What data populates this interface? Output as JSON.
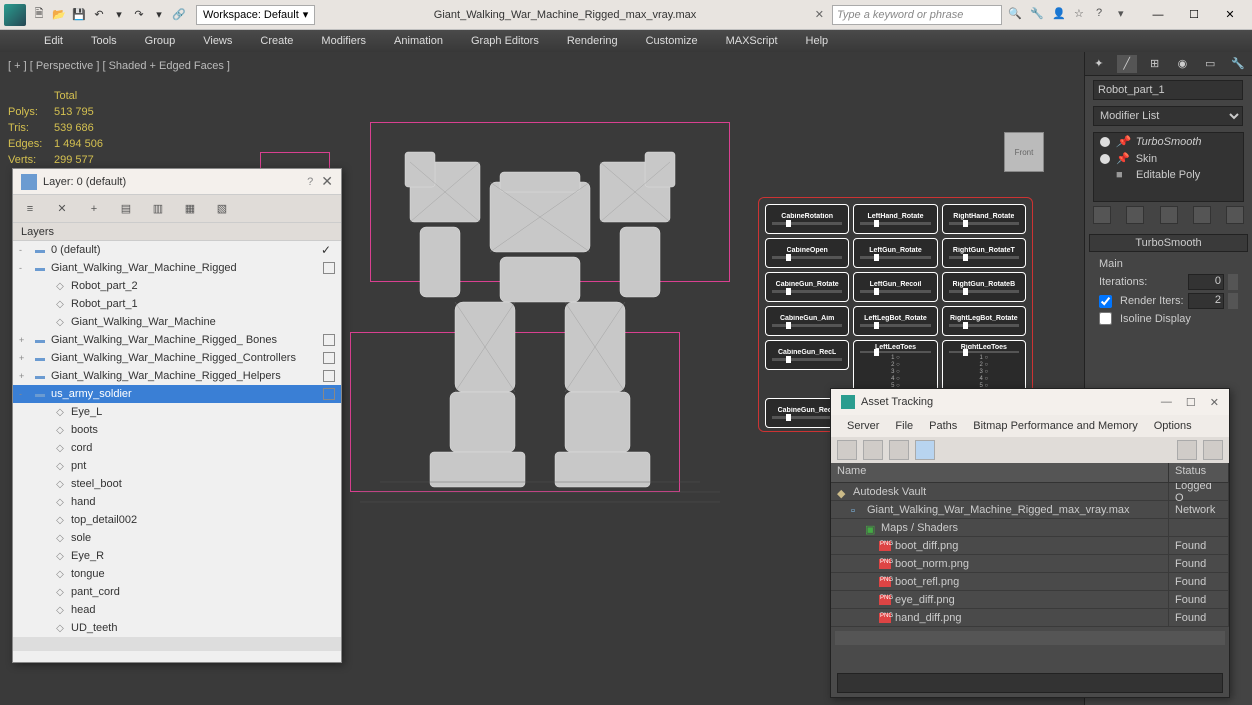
{
  "titlebar": {
    "workspace_label": "Workspace: Default",
    "filename": "Giant_Walking_War_Machine_Rigged_max_vray.max",
    "search_placeholder": "Type a keyword or phrase"
  },
  "menubar": [
    "Edit",
    "Tools",
    "Group",
    "Views",
    "Create",
    "Modifiers",
    "Animation",
    "Graph Editors",
    "Rendering",
    "Customize",
    "MAXScript",
    "Help"
  ],
  "viewport": {
    "label": "[ + ] [ Perspective ] [ Shaded + Edged Faces ]",
    "stats_header": "Total",
    "stats": [
      {
        "label": "Polys:",
        "value": "513 795"
      },
      {
        "label": "Tris:",
        "value": "539 686"
      },
      {
        "label": "Edges:",
        "value": "1 494 506"
      },
      {
        "label": "Verts:",
        "value": "299 577"
      }
    ],
    "viewcube_face": "Front"
  },
  "controls": [
    {
      "label": "CabineRotation"
    },
    {
      "label": "LeftHand_Rotate"
    },
    {
      "label": "RightHand_Rotate"
    },
    {
      "label": "CabineOpen"
    },
    {
      "label": "LeftGun_Rotate"
    },
    {
      "label": "RightGun_RotateT"
    },
    {
      "label": "CabineGun_Rotate"
    },
    {
      "label": "LeftGun_Recoil"
    },
    {
      "label": "RightGun_RotateB"
    },
    {
      "label": "CabineGun_Aim"
    },
    {
      "label": "LeftLegBot_Rotate"
    },
    {
      "label": "RightLegBot_Rotate"
    },
    {
      "label": "CabineGun_RecL"
    },
    {
      "label": "LeftLegToes",
      "tall": true
    },
    {
      "label": "RightLegToes",
      "tall": true
    },
    {
      "label": "CabineGun_RecR"
    }
  ],
  "cmd_panel": {
    "selected_name": "Robot_part_1",
    "modifier_list_label": "Modifier List",
    "stack": [
      {
        "name": "TurboSmooth",
        "italic": true,
        "bulb": true,
        "pin": true
      },
      {
        "name": "Skin",
        "italic": false,
        "bulb": true,
        "pin": true
      },
      {
        "name": "Editable Poly",
        "italic": false,
        "bulb": false,
        "pin": false
      }
    ],
    "rollout_title": "TurboSmooth",
    "section_main": "Main",
    "iterations_label": "Iterations:",
    "iterations_value": "0",
    "render_iters_label": "Render Iters:",
    "render_iters_value": "2",
    "render_iters_checked": true,
    "isoline_label": "Isoline Display",
    "isoline_checked": false
  },
  "layer_dialog": {
    "title": "Layer: 0 (default)",
    "col_header": "Layers",
    "tree": [
      {
        "indent": 0,
        "exp": "-",
        "icon": "layer",
        "label": "0 (default)",
        "check": true
      },
      {
        "indent": 0,
        "exp": "-",
        "icon": "layer",
        "label": "Giant_Walking_War_Machine_Rigged",
        "box": true
      },
      {
        "indent": 1,
        "exp": "",
        "icon": "obj",
        "label": "Robot_part_2"
      },
      {
        "indent": 1,
        "exp": "",
        "icon": "obj",
        "label": "Robot_part_1"
      },
      {
        "indent": 1,
        "exp": "",
        "icon": "obj",
        "label": "Giant_Walking_War_Machine"
      },
      {
        "indent": 0,
        "exp": "+",
        "icon": "layer",
        "label": "Giant_Walking_War_Machine_Rigged_ Bones",
        "box": true
      },
      {
        "indent": 0,
        "exp": "+",
        "icon": "layer",
        "label": "Giant_Walking_War_Machine_Rigged_Controllers",
        "box": true
      },
      {
        "indent": 0,
        "exp": "+",
        "icon": "layer",
        "label": "Giant_Walking_War_Machine_Rigged_Helpers",
        "box": true
      },
      {
        "indent": 0,
        "exp": "-",
        "icon": "layer",
        "label": "us_army_soldier",
        "box": true,
        "selected": true
      },
      {
        "indent": 1,
        "exp": "",
        "icon": "obj",
        "label": "Eye_L"
      },
      {
        "indent": 1,
        "exp": "",
        "icon": "obj",
        "label": "boots"
      },
      {
        "indent": 1,
        "exp": "",
        "icon": "obj",
        "label": "cord"
      },
      {
        "indent": 1,
        "exp": "",
        "icon": "obj",
        "label": "pnt"
      },
      {
        "indent": 1,
        "exp": "",
        "icon": "obj",
        "label": "steel_boot"
      },
      {
        "indent": 1,
        "exp": "",
        "icon": "obj",
        "label": "hand"
      },
      {
        "indent": 1,
        "exp": "",
        "icon": "obj",
        "label": "top_detail002"
      },
      {
        "indent": 1,
        "exp": "",
        "icon": "obj",
        "label": "sole"
      },
      {
        "indent": 1,
        "exp": "",
        "icon": "obj",
        "label": "Eye_R"
      },
      {
        "indent": 1,
        "exp": "",
        "icon": "obj",
        "label": "tongue"
      },
      {
        "indent": 1,
        "exp": "",
        "icon": "obj",
        "label": "pant_cord"
      },
      {
        "indent": 1,
        "exp": "",
        "icon": "obj",
        "label": "head"
      },
      {
        "indent": 1,
        "exp": "",
        "icon": "obj",
        "label": "UD_teeth"
      }
    ]
  },
  "asset_dialog": {
    "title": "Asset Tracking",
    "menu": [
      "Server",
      "File",
      "Paths",
      "Bitmap Performance and Memory",
      "Options"
    ],
    "col_name": "Name",
    "col_status": "Status",
    "rows": [
      {
        "indent": 0,
        "icon": "vault",
        "name": "Autodesk Vault",
        "status": "Logged O"
      },
      {
        "indent": 1,
        "icon": "file",
        "name": "Giant_Walking_War_Machine_Rigged_max_vray.max",
        "status": "Network"
      },
      {
        "indent": 2,
        "icon": "folder",
        "name": "Maps / Shaders",
        "status": ""
      },
      {
        "indent": 3,
        "icon": "png",
        "name": "boot_diff.png",
        "status": "Found"
      },
      {
        "indent": 3,
        "icon": "png",
        "name": "boot_norm.png",
        "status": "Found"
      },
      {
        "indent": 3,
        "icon": "png",
        "name": "boot_refl.png",
        "status": "Found"
      },
      {
        "indent": 3,
        "icon": "png",
        "name": "eye_diff.png",
        "status": "Found"
      },
      {
        "indent": 3,
        "icon": "png",
        "name": "hand_diff.png",
        "status": "Found"
      }
    ]
  }
}
